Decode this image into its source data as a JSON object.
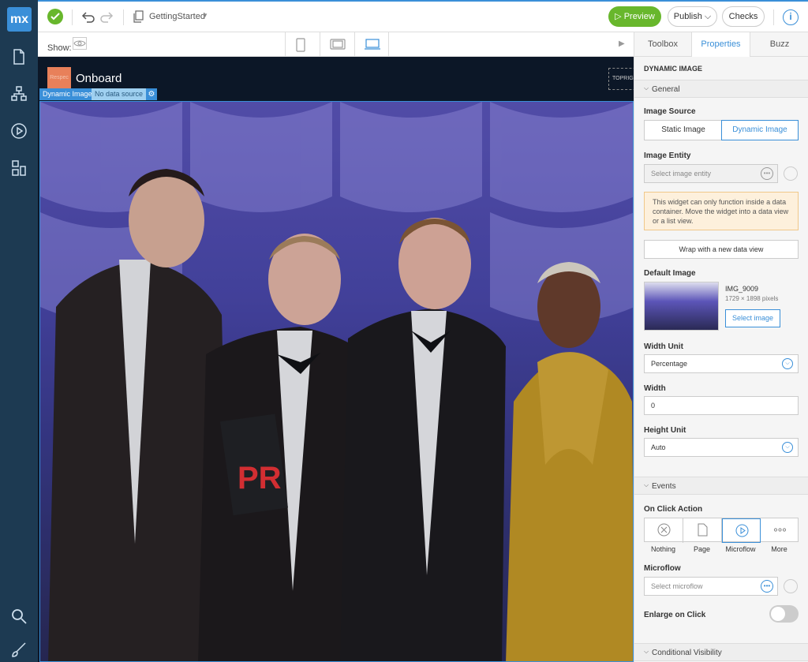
{
  "app": {
    "logo": "mx",
    "doc_title": "GettingStarted"
  },
  "toolbar": {
    "preview": "Preview",
    "publish": "Publish",
    "checks": "Checks",
    "info": "i"
  },
  "showbar": {
    "label": "Show:"
  },
  "canvas": {
    "app_logo": "Respec",
    "app_title": "Onboard",
    "topright": "TOPRIG",
    "tag_widget": "Dynamic Image",
    "tag_source": "No data source"
  },
  "panel": {
    "tabs": [
      "Toolbox",
      "Properties",
      "Buzz"
    ],
    "header": "DYNAMIC IMAGE",
    "sections": {
      "general": "General",
      "events": "Events",
      "visibility": "Conditional Visibility"
    },
    "image_source": {
      "label": "Image Source",
      "options": [
        "Static Image",
        "Dynamic Image"
      ],
      "selected": "Dynamic Image"
    },
    "image_entity": {
      "label": "Image Entity",
      "placeholder": "Select image entity"
    },
    "warning": "This widget can only function inside a data container. Move the widget into a data view or a list view.",
    "wrap_button": "Wrap with a new data view",
    "default_image": {
      "label": "Default Image",
      "file": "IMG_9009",
      "size": "1729 × 1898 pixels",
      "button": "Select image"
    },
    "width_unit": {
      "label": "Width Unit",
      "value": "Percentage"
    },
    "width": {
      "label": "Width",
      "value": "0"
    },
    "height_unit": {
      "label": "Height Unit",
      "value": "Auto"
    },
    "on_click": {
      "label": "On Click Action",
      "options": [
        "Nothing",
        "Page",
        "Microflow",
        "More"
      ],
      "selected": "Microflow"
    },
    "microflow": {
      "label": "Microflow",
      "placeholder": "Select microflow"
    },
    "enlarge": {
      "label": "Enlarge on Click",
      "enabled": false
    }
  },
  "colors": {
    "accent": "#3a8fd8",
    "success": "#68b72c",
    "rail": "#1d3a52"
  }
}
